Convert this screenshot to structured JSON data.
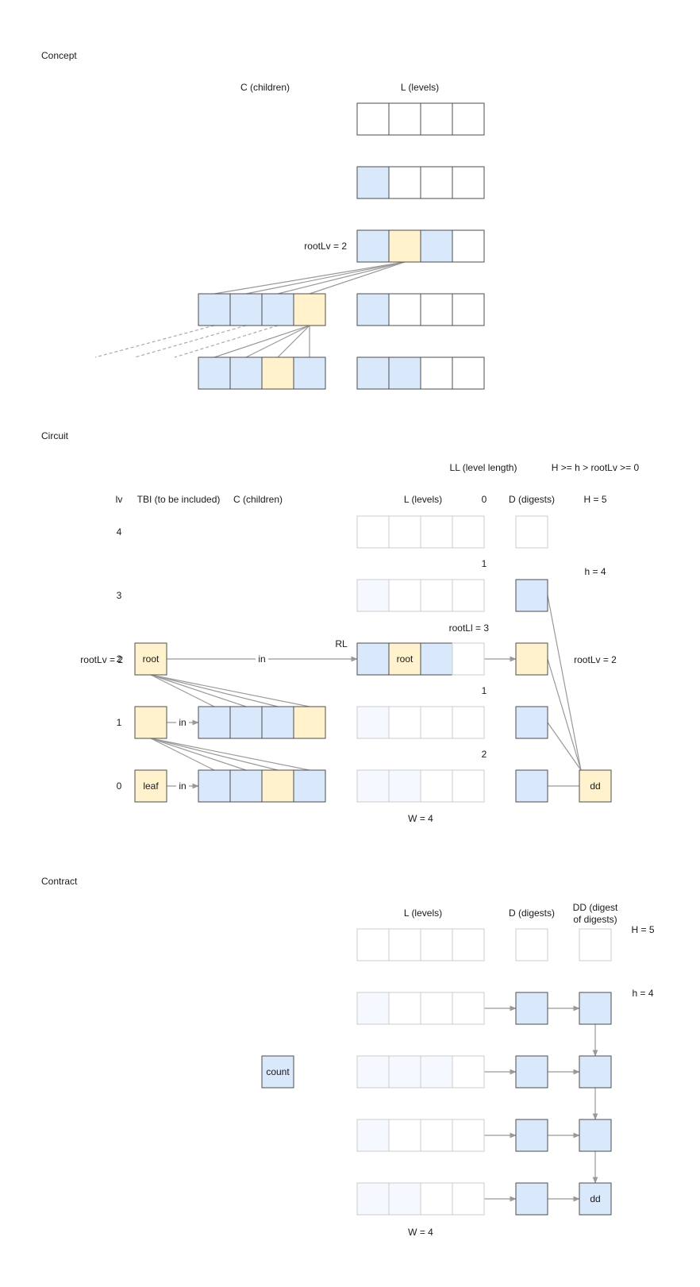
{
  "colors": {
    "blue": "#dae8fc",
    "yellow": "#fff2cc",
    "white": "#ffffff",
    "faint": "#f5f8fe",
    "stroke": "#4d4d4d",
    "faint_stroke": "#cccccc",
    "line": "#999999"
  },
  "concept": {
    "title": "Concept",
    "children_header": "C (children)",
    "levels_header": "L (levels)",
    "root_label": "rootLv = 2",
    "levels": [
      [
        "white",
        "white",
        "white",
        "white"
      ],
      [
        "blue",
        "white",
        "white",
        "white"
      ],
      [
        "blue",
        "yellow",
        "blue",
        "white"
      ],
      [
        "blue",
        "white",
        "white",
        "white"
      ],
      [
        "blue",
        "blue",
        "white",
        "white"
      ]
    ],
    "children": [
      [
        "blue",
        "blue",
        "blue",
        "yellow"
      ],
      [
        "blue",
        "blue",
        "yellow",
        "blue"
      ]
    ]
  },
  "circuit": {
    "title": "Circuit",
    "ll_header": "LL (level length)",
    "constraint": "H >= h > rootLv >= 0",
    "lv_header": "lv",
    "tbi_header": "TBI (to be included)",
    "children_header": "C (children)",
    "levels_header": "L (levels)",
    "digests_header": "D (digests)",
    "H_label": "H = 5",
    "h_label": "h = 4",
    "rootLv_right": "rootLv = 2",
    "rootLv_left": "rootLv = 2",
    "rootLl": "rootLl = 3",
    "RL": "RL",
    "in_label": "in",
    "root_text": "root",
    "leaf_text": "leaf",
    "dd_text": "dd",
    "W_label": "W = 4",
    "lv_values": [
      "4",
      "3",
      "2",
      "1",
      "0"
    ],
    "ll_values": [
      "0",
      "1",
      "1",
      "2"
    ],
    "levels": [
      [
        "white",
        "white",
        "white",
        "white"
      ],
      [
        "faint",
        "white",
        "white",
        "white"
      ],
      [
        "blue",
        "yellow",
        "blue",
        "white"
      ],
      [
        "faint",
        "white",
        "white",
        "white"
      ],
      [
        "faint",
        "faint",
        "white",
        "white"
      ]
    ],
    "digests": [
      "white",
      "blue",
      "yellow",
      "blue",
      "blue"
    ],
    "children": [
      [
        "blue",
        "blue",
        "blue",
        "yellow"
      ],
      [
        "blue",
        "blue",
        "yellow",
        "blue"
      ]
    ]
  },
  "contract": {
    "title": "Contract",
    "levels_header": "L (levels)",
    "digests_header": "D (digests)",
    "dd_header_line1": "DD (digest",
    "dd_header_line2": "of digests)",
    "H_label": "H = 5",
    "h_label": "h = 4",
    "count_text": "count",
    "dd_text": "dd",
    "W_label": "W = 4",
    "levels": [
      [
        "white",
        "white",
        "white",
        "white"
      ],
      [
        "faint",
        "white",
        "white",
        "white"
      ],
      [
        "faint",
        "faint",
        "faint",
        "white"
      ],
      [
        "faint",
        "white",
        "white",
        "white"
      ],
      [
        "faint",
        "faint",
        "white",
        "white"
      ]
    ],
    "digests": [
      "white",
      "blue",
      "blue",
      "blue",
      "blue"
    ],
    "dds": [
      "white",
      "blue",
      "blue",
      "blue",
      "blue"
    ]
  }
}
